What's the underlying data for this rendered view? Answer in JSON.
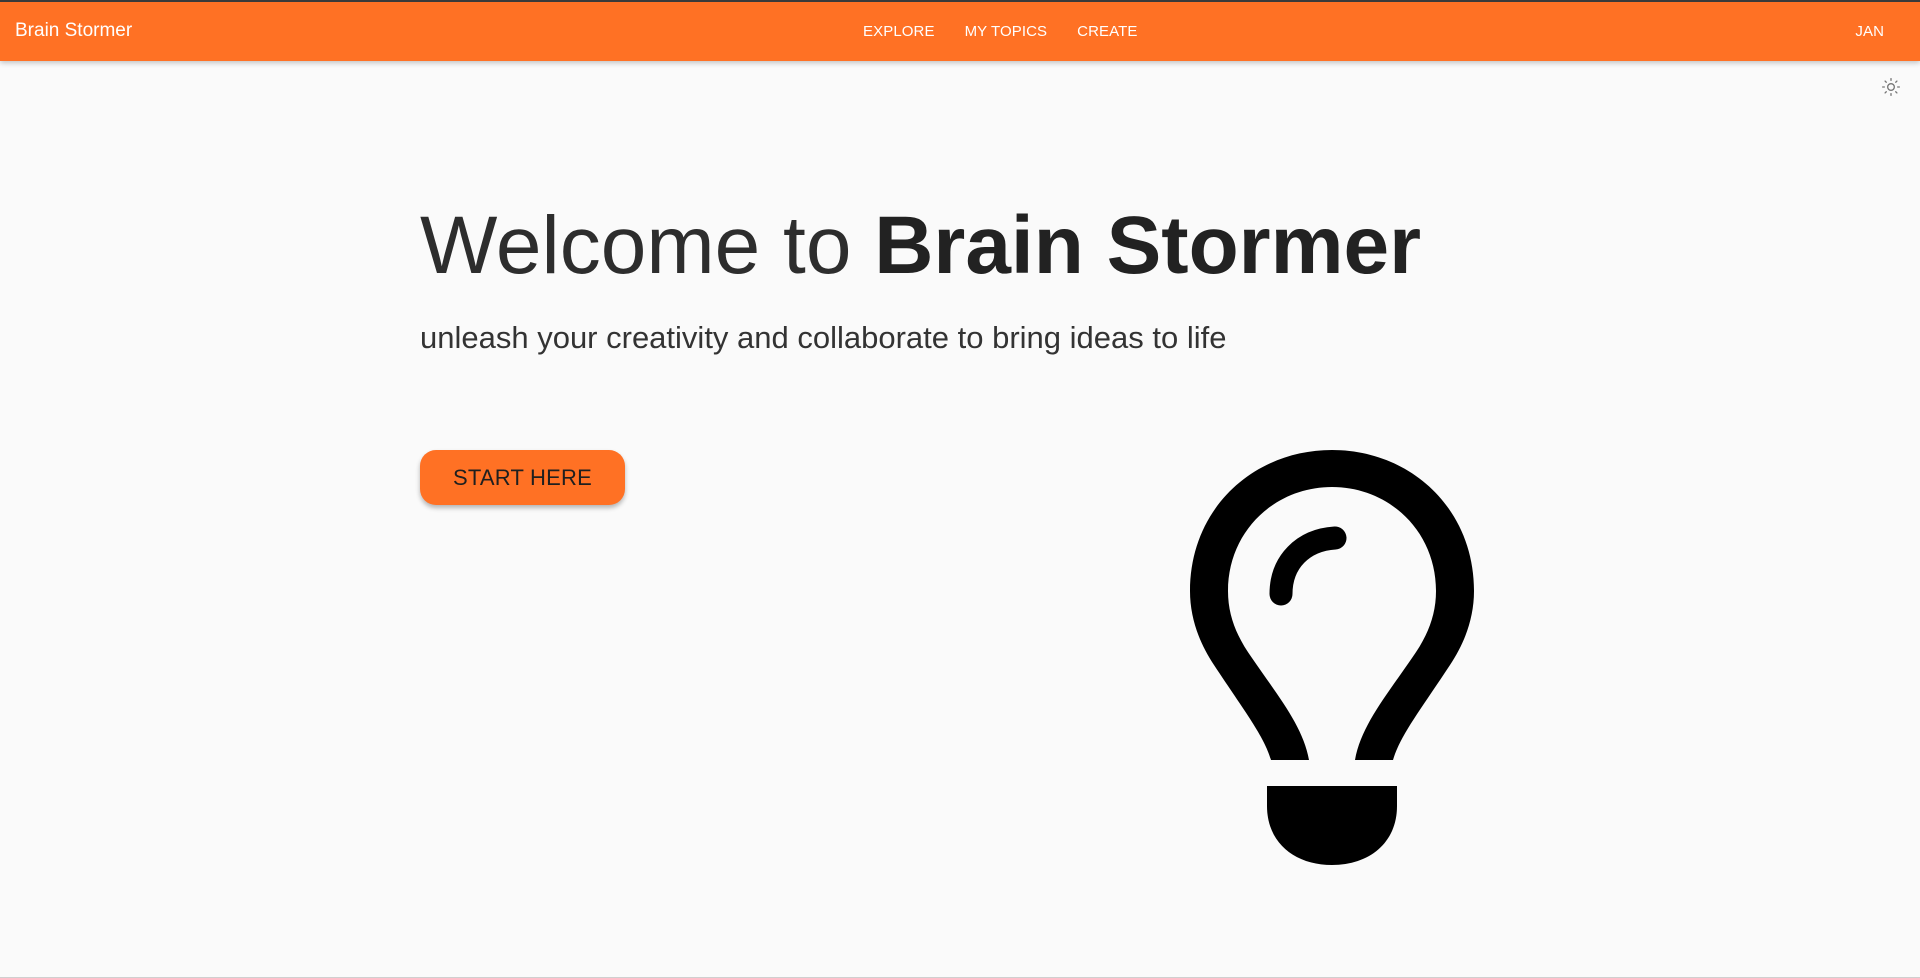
{
  "header": {
    "brand": "Brain Stormer",
    "nav": {
      "explore": "EXPLORE",
      "my_topics": "MY TOPICS",
      "create": "CREATE"
    },
    "user": "JAN"
  },
  "theme_toggle": {
    "icon": "sun-icon"
  },
  "hero": {
    "title_prefix": "Welcome to ",
    "title_brand": "Brain Stormer",
    "subtitle": "unleash your creativity and collaborate to bring ideas to life",
    "cta": "START HERE"
  },
  "illustration": {
    "icon": "lightbulb-icon"
  },
  "colors": {
    "accent": "#ff7124",
    "background": "#fafafa",
    "text": "#222222"
  }
}
